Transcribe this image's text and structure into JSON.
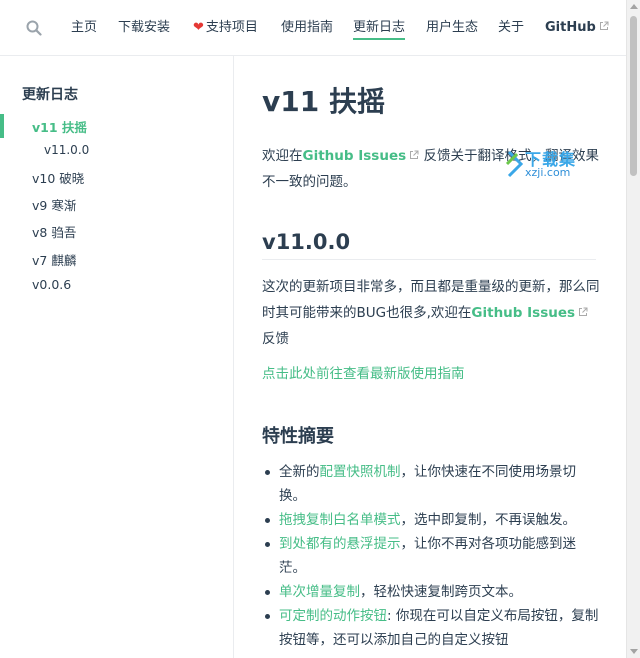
{
  "navbar": {
    "items": [
      {
        "label": "主页"
      },
      {
        "label": "下载安装"
      },
      {
        "label": "支持项目"
      },
      {
        "label": "使用指南"
      },
      {
        "label": "更新日志"
      },
      {
        "label": "用户生态"
      },
      {
        "label": "关于"
      },
      {
        "label": "GitHub"
      }
    ],
    "active": "更新日志"
  },
  "sidebar": {
    "title": "更新日志",
    "items": [
      {
        "label": "v11 扶摇"
      },
      {
        "label": "v11.0.0"
      },
      {
        "label": "v10 破晓"
      },
      {
        "label": "v9 寒渐"
      },
      {
        "label": "v8 驺吾"
      },
      {
        "label": "v7 麒麟"
      },
      {
        "label": "v0.0.6"
      }
    ]
  },
  "main": {
    "title": "v11 扶摇",
    "intro": {
      "prefix": "欢迎在",
      "link": "Github Issues",
      "suffix": " 反馈关于翻译格式，翻译效果不一致的问题。"
    },
    "version_heading": "v11.0.0",
    "version_para": {
      "prefix": "这次的更新项目非常多，而且都是重量级的更新，那么同时其可能带来的BUG也很多,欢迎在",
      "link": "Github Issues",
      "suffix": " 反馈"
    },
    "guide_link": "点击此处前往查看最新版使用指南",
    "features_heading": "特性摘要",
    "features": [
      {
        "pre": "全新的",
        "link": "配置快照机制",
        "post": "，让你快速在不同使用场景切换。"
      },
      {
        "pre": "",
        "link": "拖拽复制白名单模式",
        "post": "，选中即复制，不再误触发。"
      },
      {
        "pre": "",
        "link": "到处都有的悬浮提示",
        "post": "，让你不再对各项功能感到迷茫。"
      },
      {
        "pre": "",
        "link": "单次增量复制",
        "post": "，轻松快速复制跨页文本。"
      },
      {
        "pre": "",
        "link": "可定制的动作按钮",
        "post": ": 你现在可以自定义布局按钮，复制按钮等，还可以添加自己的自定义按钮"
      }
    ]
  },
  "watermark": {
    "top": "下载集",
    "bottom": "xzji.com"
  },
  "colors": {
    "accent": "#46bd87",
    "text": "#2c3e50"
  }
}
